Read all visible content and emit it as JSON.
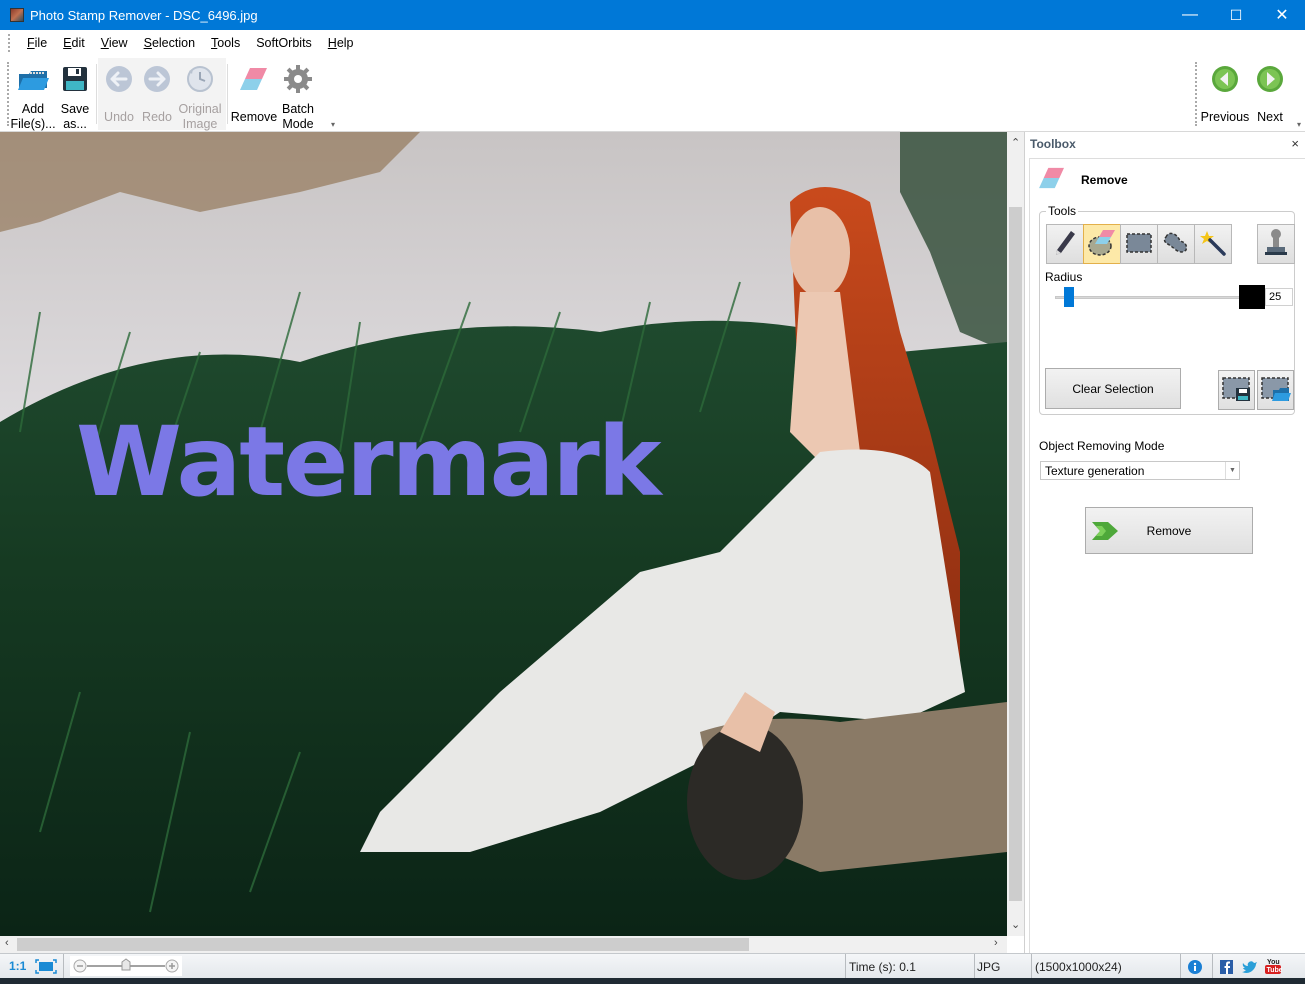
{
  "window": {
    "title": "Photo Stamp Remover - DSC_6496.jpg",
    "controls": {
      "minimize": "—",
      "maximize": "☐",
      "close": "✕"
    }
  },
  "menu": [
    {
      "label": "File",
      "accel": "F"
    },
    {
      "label": "Edit",
      "accel": "E"
    },
    {
      "label": "View",
      "accel": "V"
    },
    {
      "label": "Selection",
      "accel": "S"
    },
    {
      "label": "Tools",
      "accel": "T"
    },
    {
      "label": "SoftOrbits",
      "accel": ""
    },
    {
      "label": "Help",
      "accel": "H"
    }
  ],
  "toolbar": {
    "add_files": {
      "line1": "Add",
      "line2": "File(s)...",
      "icon": "open-folder-icon",
      "enabled": true
    },
    "save_as": {
      "line1": "Save",
      "line2": "as...",
      "icon": "floppy-disk-icon",
      "enabled": true
    },
    "undo": {
      "label": "Undo",
      "icon": "undo-arrow-icon",
      "enabled": false
    },
    "redo": {
      "label": "Redo",
      "icon": "redo-arrow-icon",
      "enabled": false
    },
    "original_image": {
      "line1": "Original",
      "line2": "Image",
      "icon": "clock-history-icon",
      "enabled": false
    },
    "remove": {
      "label": "Remove",
      "icon": "eraser-icon",
      "enabled": true
    },
    "batch_mode": {
      "line1": "Batch",
      "line2": "Mode",
      "icon": "gear-icon",
      "enabled": true
    },
    "previous": {
      "label": "Previous",
      "icon": "green-left-arrow-icon"
    },
    "next": {
      "label": "Next",
      "icon": "green-right-arrow-icon"
    }
  },
  "canvas": {
    "watermark_text": "Watermark",
    "watermark_color": "#7b78e6",
    "image_description": "Red-haired woman in white lace dress sitting on log by a lake among tall grass"
  },
  "toolbox": {
    "title": "Toolbox",
    "close": "×",
    "section_title": "Remove",
    "tools_label": "Tools",
    "tools": [
      {
        "name": "pencil",
        "icon": "pencil-icon",
        "active": false
      },
      {
        "name": "eraser-lasso",
        "icon": "eraser-selection-icon",
        "active": true
      },
      {
        "name": "rectangle-select",
        "icon": "rectangle-selection-icon",
        "active": false
      },
      {
        "name": "lasso-select",
        "icon": "lasso-selection-icon",
        "active": false
      },
      {
        "name": "magic-wand",
        "icon": "magic-wand-icon",
        "active": false
      },
      {
        "name": "stamp",
        "icon": "stamp-icon",
        "active": false
      }
    ],
    "radius_label": "Radius",
    "radius_value": "25",
    "radius_slider_fraction": 0.05,
    "clear_selection": "Clear Selection",
    "save_selection_icon": "save-selection-icon",
    "load_selection_icon": "load-selection-icon",
    "mode_label": "Object Removing Mode",
    "mode_value": "Texture generation",
    "remove_button": "Remove"
  },
  "statusbar": {
    "zoom_1to1": "1:1",
    "fit_icon": "fit-to-screen-icon",
    "zoom_fraction": 0.5,
    "time": "Time (s): 0.1",
    "format": "JPG",
    "dimensions": "(1500x1000x24)",
    "icons": [
      "info-icon",
      "facebook-icon",
      "twitter-icon",
      "youtube-icon"
    ]
  },
  "colors": {
    "titlebar": "#0078d7",
    "accent": "#0078d7",
    "active_tool": "#fde9a8",
    "green_nav": "#5aa83c"
  }
}
